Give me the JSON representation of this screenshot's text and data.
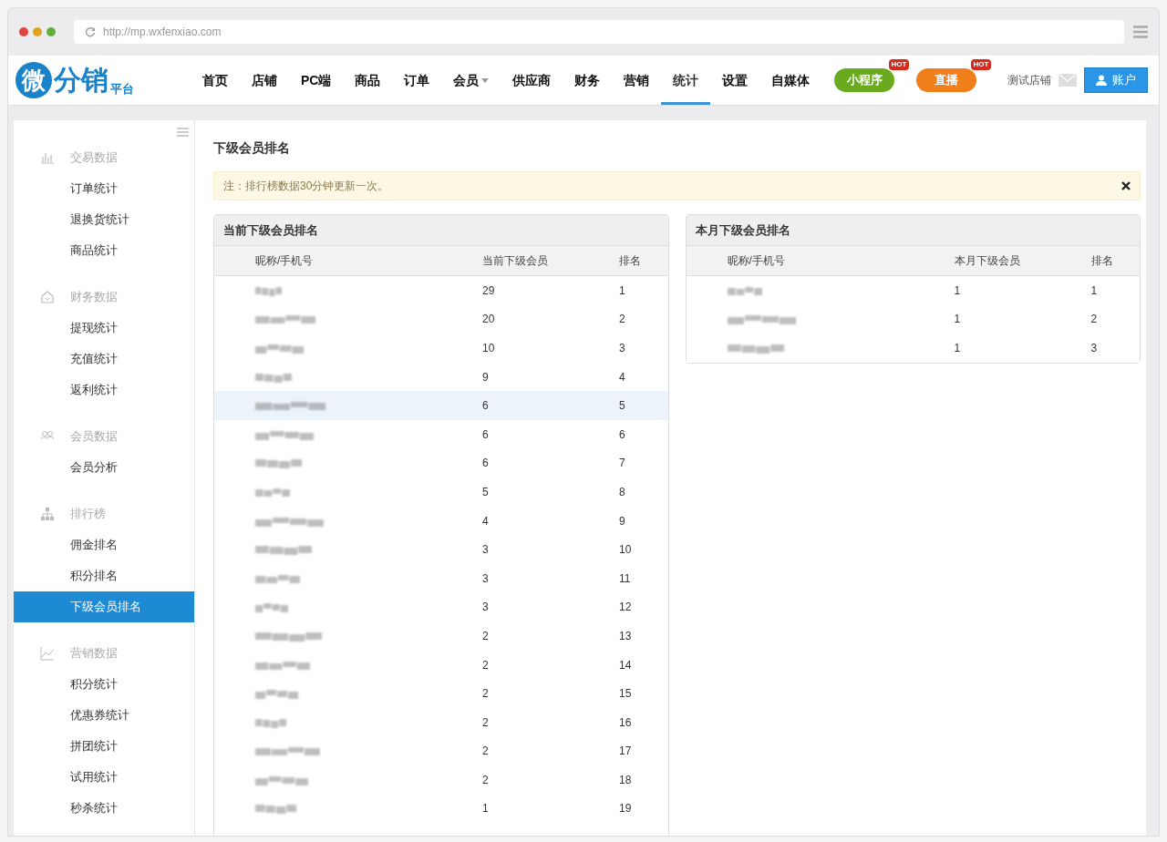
{
  "browser": {
    "url": "http://mp.wxfenxiao.com"
  },
  "logo": {
    "mark": "微",
    "name": "分销",
    "sub": "平台"
  },
  "nav": [
    {
      "label": "首页",
      "selected": false,
      "has_menu": false
    },
    {
      "label": "店铺",
      "selected": false,
      "has_menu": false
    },
    {
      "label": "PC端",
      "selected": false,
      "has_menu": false
    },
    {
      "label": "商品",
      "selected": false,
      "has_menu": false
    },
    {
      "label": "订单",
      "selected": false,
      "has_menu": false
    },
    {
      "label": "会员",
      "selected": false,
      "has_menu": true
    },
    {
      "label": "供应商",
      "selected": false,
      "has_menu": false
    },
    {
      "label": "财务",
      "selected": false,
      "has_menu": false
    },
    {
      "label": "营销",
      "selected": false,
      "has_menu": false
    },
    {
      "label": "统计",
      "selected": true,
      "has_menu": false
    },
    {
      "label": "设置",
      "selected": false,
      "has_menu": false
    },
    {
      "label": "自媒体",
      "selected": false,
      "has_menu": false
    }
  ],
  "promo_buttons": [
    {
      "label": "小程序",
      "color": "#6aaa1e",
      "badge": "HOT"
    },
    {
      "label": "直播",
      "color": "#f07e1b",
      "badge": "HOT"
    }
  ],
  "store_name": "测试店铺",
  "account_button": "账户",
  "sidebar": [
    {
      "title": "交易数据",
      "items": [
        {
          "label": "订单统计",
          "selected": false
        },
        {
          "label": "退换货统计",
          "selected": false
        },
        {
          "label": "商品统计",
          "selected": false
        }
      ]
    },
    {
      "title": "财务数据",
      "items": [
        {
          "label": "提现统计",
          "selected": false
        },
        {
          "label": "充值统计",
          "selected": false
        },
        {
          "label": "返利统计",
          "selected": false
        }
      ]
    },
    {
      "title": "会员数据",
      "items": [
        {
          "label": "会员分析",
          "selected": false
        }
      ]
    },
    {
      "title": "排行榜",
      "items": [
        {
          "label": "佣金排名",
          "selected": false
        },
        {
          "label": "积分排名",
          "selected": false
        },
        {
          "label": "下级会员排名",
          "selected": true
        }
      ]
    },
    {
      "title": "营销数据",
      "items": [
        {
          "label": "积分统计",
          "selected": false
        },
        {
          "label": "优惠券统计",
          "selected": false
        },
        {
          "label": "拼团统计",
          "selected": false
        },
        {
          "label": "试用统计",
          "selected": false
        },
        {
          "label": "秒杀统计",
          "selected": false
        }
      ]
    }
  ],
  "page_title": "下级会员排名",
  "notice": "注：排行榜数据30分钟更新一次。",
  "panels": [
    {
      "title": "当前下级会员排名",
      "columns": [
        "昵称/手机号",
        "当前下级会员",
        "排名"
      ],
      "rows": [
        {
          "count": "29",
          "rank": "1",
          "highlighted": false
        },
        {
          "count": "20",
          "rank": "2",
          "highlighted": false
        },
        {
          "count": "10",
          "rank": "3",
          "highlighted": false
        },
        {
          "count": "9",
          "rank": "4",
          "highlighted": false
        },
        {
          "count": "6",
          "rank": "5",
          "highlighted": true
        },
        {
          "count": "6",
          "rank": "6",
          "highlighted": false
        },
        {
          "count": "6",
          "rank": "7",
          "highlighted": false
        },
        {
          "count": "5",
          "rank": "8",
          "highlighted": false
        },
        {
          "count": "4",
          "rank": "9",
          "highlighted": false
        },
        {
          "count": "3",
          "rank": "10",
          "highlighted": false
        },
        {
          "count": "3",
          "rank": "11",
          "highlighted": false
        },
        {
          "count": "3",
          "rank": "12",
          "highlighted": false
        },
        {
          "count": "2",
          "rank": "13",
          "highlighted": false
        },
        {
          "count": "2",
          "rank": "14",
          "highlighted": false
        },
        {
          "count": "2",
          "rank": "15",
          "highlighted": false
        },
        {
          "count": "2",
          "rank": "16",
          "highlighted": false
        },
        {
          "count": "2",
          "rank": "17",
          "highlighted": false
        },
        {
          "count": "2",
          "rank": "18",
          "highlighted": false
        },
        {
          "count": "1",
          "rank": "19",
          "highlighted": false
        }
      ]
    },
    {
      "title": "本月下级会员排名",
      "columns": [
        "昵称/手机号",
        "本月下级会员",
        "排名"
      ],
      "rows": [
        {
          "count": "1",
          "rank": "1",
          "highlighted": false
        },
        {
          "count": "1",
          "rank": "2",
          "highlighted": false
        },
        {
          "count": "1",
          "rank": "3",
          "highlighted": false
        }
      ]
    }
  ]
}
